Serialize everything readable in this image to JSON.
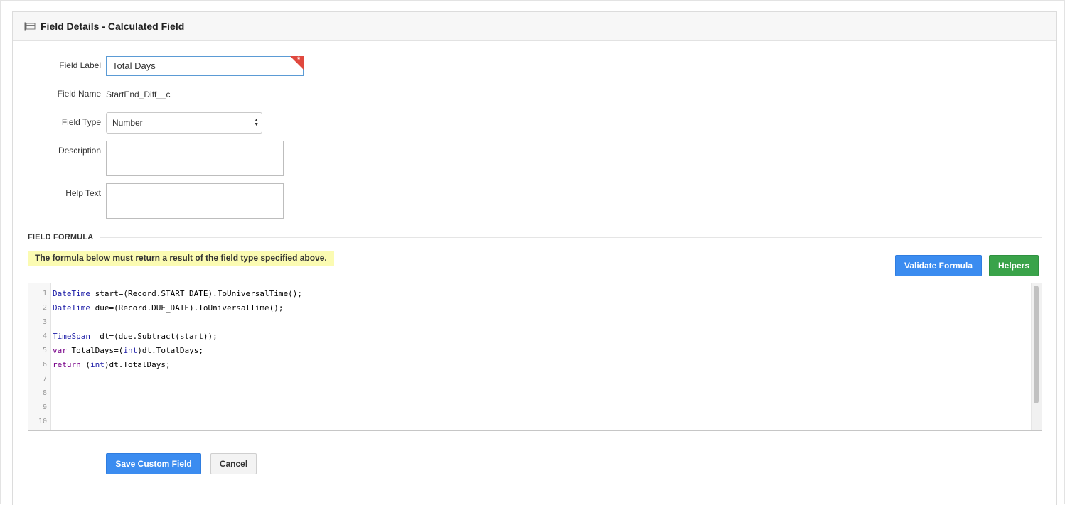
{
  "header": {
    "title": "Field Details - Calculated Field",
    "icon": "field-details-icon"
  },
  "form": {
    "field_label": {
      "label": "Field Label",
      "value": "Total Days",
      "required_marker": "*"
    },
    "field_name": {
      "label": "Field Name",
      "value": "StartEnd_Diff__c"
    },
    "field_type": {
      "label": "Field Type",
      "selected": "Number"
    },
    "description": {
      "label": "Description",
      "value": ""
    },
    "help_text": {
      "label": "Help Text",
      "value": ""
    }
  },
  "formula": {
    "section_title": "FIELD FORMULA",
    "notice": "The formula below must return a result of the field type specified above.",
    "validate_label": "Validate Formula",
    "helpers_label": "Helpers",
    "line_numbers": [
      "1",
      "2",
      "3",
      "4",
      "5",
      "6",
      "7",
      "8",
      "9",
      "10"
    ],
    "lines": [
      {
        "type": "DateTime",
        "rest": " start=(Record.START_DATE).ToUniversalTime();"
      },
      {
        "type": "DateTime",
        "rest": " due=(Record.DUE_DATE).ToUniversalTime();"
      },
      {
        "text": ""
      },
      {
        "type": "TimeSpan",
        "rest": "  dt=(due.Subtract(start));"
      },
      {
        "kw": "var",
        "mid": " TotalDays=(",
        "type": "int",
        "rest": ")dt.TotalDays;"
      },
      {
        "kw": "return",
        "mid": " (",
        "type": "int",
        "rest": ")dt.TotalDays;"
      }
    ]
  },
  "footer": {
    "save_label": "Save Custom Field",
    "cancel_label": "Cancel"
  },
  "colors": {
    "primary": "#3b8cf0",
    "success": "#3aa34a",
    "notice_bg": "#fbfbb2",
    "required": "#e0483e"
  }
}
